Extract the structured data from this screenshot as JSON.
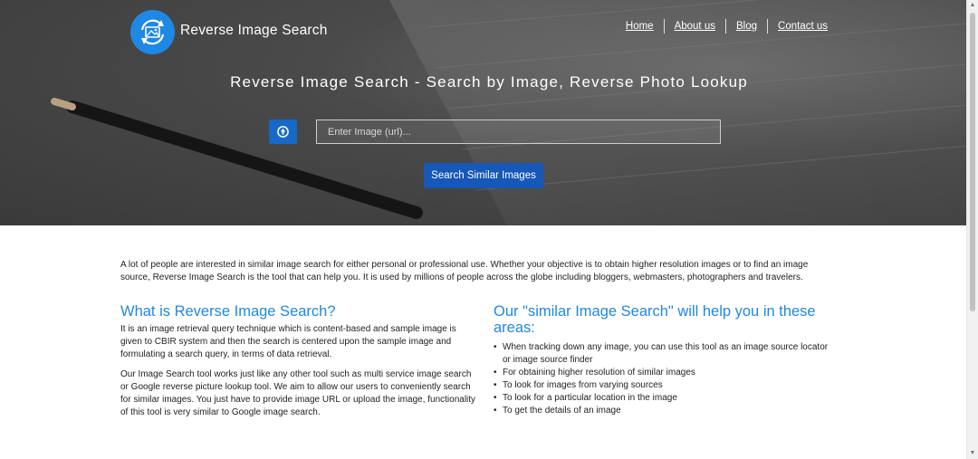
{
  "header": {
    "brand": "Reverse Image Search",
    "nav": [
      "Home",
      "About us",
      "Blog",
      "Contact us"
    ]
  },
  "hero": {
    "title": "Reverse Image Search - Search by Image, Reverse Photo Lookup",
    "input_placeholder": "Enter Image (url)...",
    "search_label": "Search Similar Images"
  },
  "content": {
    "intro": "A lot of people are interested in similar image search for either personal or professional use. Whether your objective is to obtain higher resolution images or to find an image source, Reverse Image Search is the tool that can help you. It is used by millions of people across the globe including bloggers, webmasters, photographers and travelers.",
    "left": {
      "heading": "What is Reverse Image Search?",
      "paragraphs": [
        "It is an image retrieval query technique which is content-based and sample image is given to CBIR system and then the search is centered upon the sample image and formulating a search query, in terms of data retrieval.",
        "Our Image Search tool works just like any other tool such as multi service image search or Google reverse picture lookup tool. We aim to allow our users to conveniently search for similar images. You just have to provide image URL or upload the image, functionality of this tool is very similar to Google image search."
      ]
    },
    "right": {
      "heading": "Our \"similar Image Search\" will help you in these areas:",
      "items": [
        "When tracking down any image, you can use this tool as an image source locator or image source finder",
        "For obtaining higher resolution of similar images",
        "To look for images from varying sources",
        "To look for a particular location in the image",
        "To get the details of an image"
      ]
    }
  },
  "icons": {
    "logo": "image-search-logo-icon",
    "upload": "upload-arrow-icon"
  },
  "colors": {
    "accent": "#1e88e5",
    "button": "#1558b8",
    "hero_bg": "#4a4a4a"
  }
}
